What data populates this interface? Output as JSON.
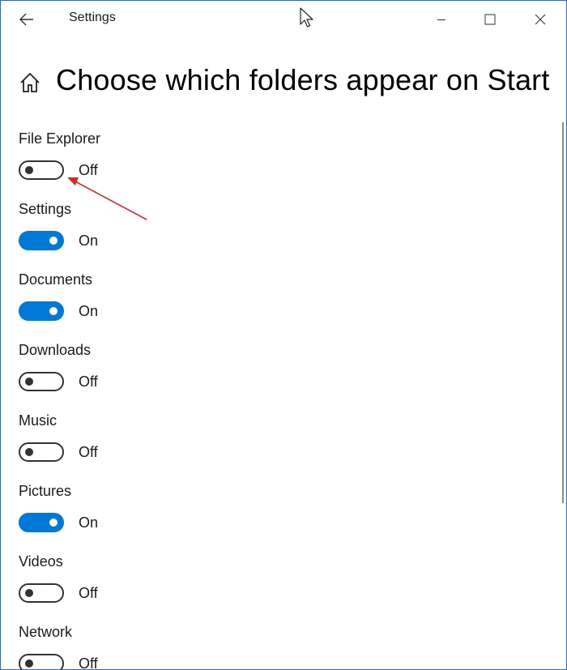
{
  "window": {
    "title": "Settings",
    "controls": {
      "minimize": "minimize-icon",
      "maximize": "maximize-icon",
      "close": "close-icon"
    }
  },
  "header": {
    "title": "Choose which folders appear on Start",
    "icon": "home-icon"
  },
  "colors": {
    "accent": "#0078d7",
    "toggle_off": "#333333",
    "annotation": "#d9282b"
  },
  "settings": [
    {
      "label": "File Explorer",
      "state": "Off",
      "on": false
    },
    {
      "label": "Settings",
      "state": "On",
      "on": true
    },
    {
      "label": "Documents",
      "state": "On",
      "on": true
    },
    {
      "label": "Downloads",
      "state": "Off",
      "on": false
    },
    {
      "label": "Music",
      "state": "Off",
      "on": false
    },
    {
      "label": "Pictures",
      "state": "On",
      "on": true
    },
    {
      "label": "Videos",
      "state": "Off",
      "on": false
    },
    {
      "label": "Network",
      "state": "Off",
      "on": false
    }
  ]
}
